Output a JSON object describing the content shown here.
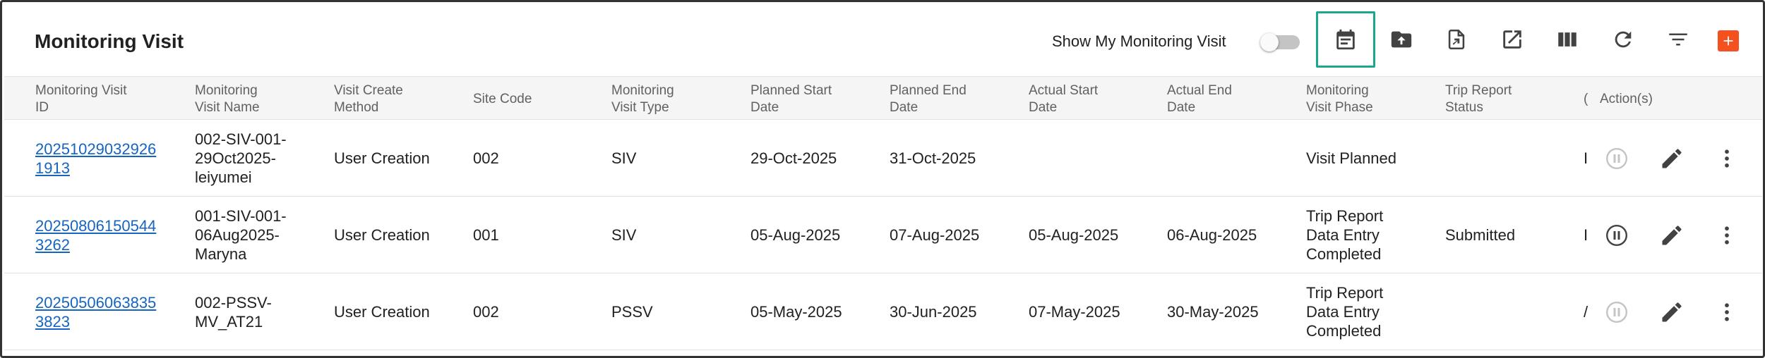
{
  "page": {
    "title": "Monitoring Visit"
  },
  "toolbar": {
    "toggle_label": "Show My Monitoring Visit",
    "toggle_on": false,
    "icons": [
      "calendar-icon",
      "upload-folder-icon",
      "export-file-icon",
      "open-external-icon",
      "columns-icon",
      "refresh-icon",
      "filter-icon",
      "add-icon"
    ]
  },
  "colors": {
    "link": "#1565c0",
    "add_button": "#f4511e",
    "highlight": "#1ba88a",
    "header_bg": "#f5f5f5"
  },
  "table": {
    "columns": [
      "Monitoring Visit\nID",
      "Monitoring\nVisit Name",
      "Visit Create\nMethod",
      "Site Code",
      "Monitoring\nVisit Type",
      "Planned Start\nDate",
      "Planned End\nDate",
      "Actual Start\nDate",
      "Actual End\nDate",
      "Monitoring\nVisit Phase",
      "Trip Report\nStatus",
      "(",
      "Action(s)"
    ],
    "rows": [
      {
        "id": "20251029032926\n1913",
        "name": "002-SIV-001-\n29Oct2025-\nleiyumei",
        "method": "User Creation",
        "site": "002",
        "type": "SIV",
        "planned_start": "29-Oct-2025",
        "planned_end": "31-Oct-2025",
        "actual_start": "",
        "actual_end": "",
        "phase": "Visit Planned",
        "trip_status": "",
        "clipped": "I",
        "pause_enabled": false
      },
      {
        "id": "20250806150544\n3262",
        "name": "001-SIV-001-\n06Aug2025-\nMaryna",
        "method": "User Creation",
        "site": "001",
        "type": "SIV",
        "planned_start": "05-Aug-2025",
        "planned_end": "07-Aug-2025",
        "actual_start": "05-Aug-2025",
        "actual_end": "06-Aug-2025",
        "phase": "Trip Report\nData Entry\nCompleted",
        "trip_status": "Submitted",
        "clipped": "I",
        "pause_enabled": true
      },
      {
        "id": "20250506063835\n3823",
        "name": "002-PSSV-\nMV_AT21",
        "method": "User Creation",
        "site": "002",
        "type": "PSSV",
        "planned_start": "05-May-2025",
        "planned_end": "30-Jun-2025",
        "actual_start": "07-May-2025",
        "actual_end": "30-May-2025",
        "phase": "Trip Report\nData Entry\nCompleted",
        "trip_status": "",
        "clipped": "/",
        "pause_enabled": false
      }
    ]
  }
}
